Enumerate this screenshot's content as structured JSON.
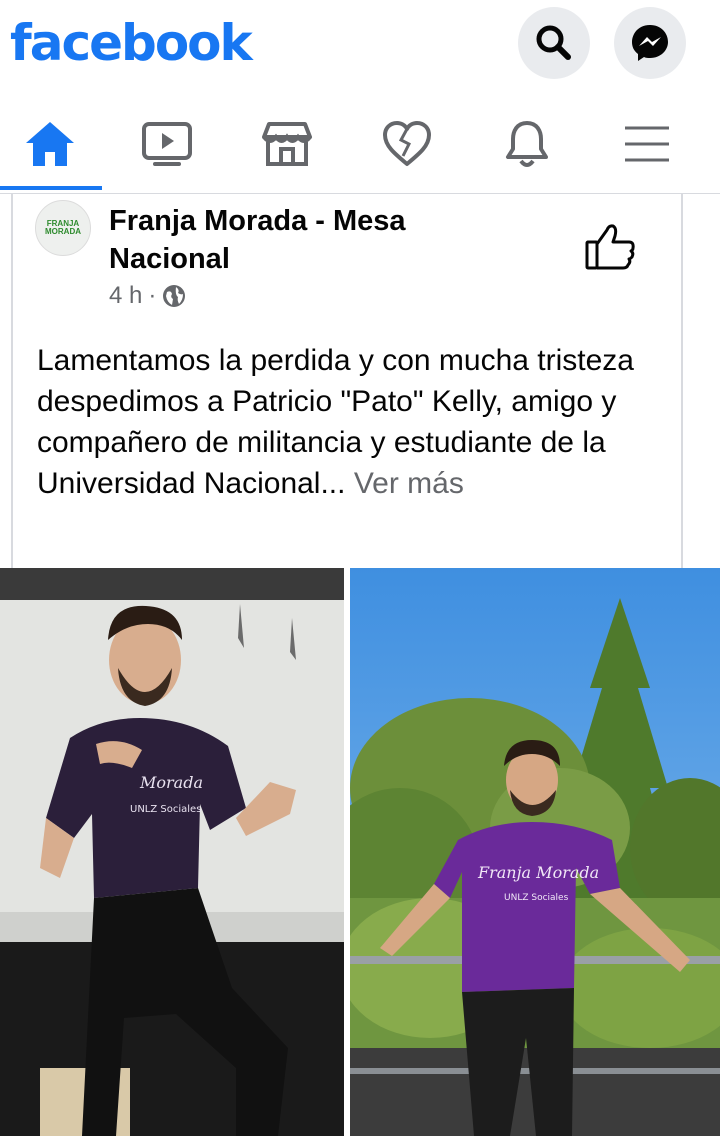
{
  "header": {
    "logo": "facebook",
    "icons": [
      "search-icon",
      "messenger-icon"
    ]
  },
  "nav": {
    "tabs": [
      {
        "icon": "home-icon",
        "active": true
      },
      {
        "icon": "video-icon",
        "active": false
      },
      {
        "icon": "marketplace-icon",
        "active": false
      },
      {
        "icon": "dating-heart-icon",
        "active": false
      },
      {
        "icon": "bell-icon",
        "active": false
      },
      {
        "icon": "menu-icon",
        "active": false
      }
    ]
  },
  "post": {
    "page_name": "Franja Morada - Mesa Nacional",
    "avatar_text": "FRANJA MORADA",
    "time": "4 h",
    "separator": "·",
    "audience_icon": "globe-icon",
    "text": "Lamentamos la perdida y con mucha tristeza despedimos a Patricio \"Pato\" Kelly, amigo y compañero de militancia y estudiante de la Universidad Nacional...",
    "see_more": " Ver más"
  },
  "colors": {
    "brand": "#1877f2",
    "secondary_text": "#65676b",
    "button_bg": "#e9ebee"
  }
}
